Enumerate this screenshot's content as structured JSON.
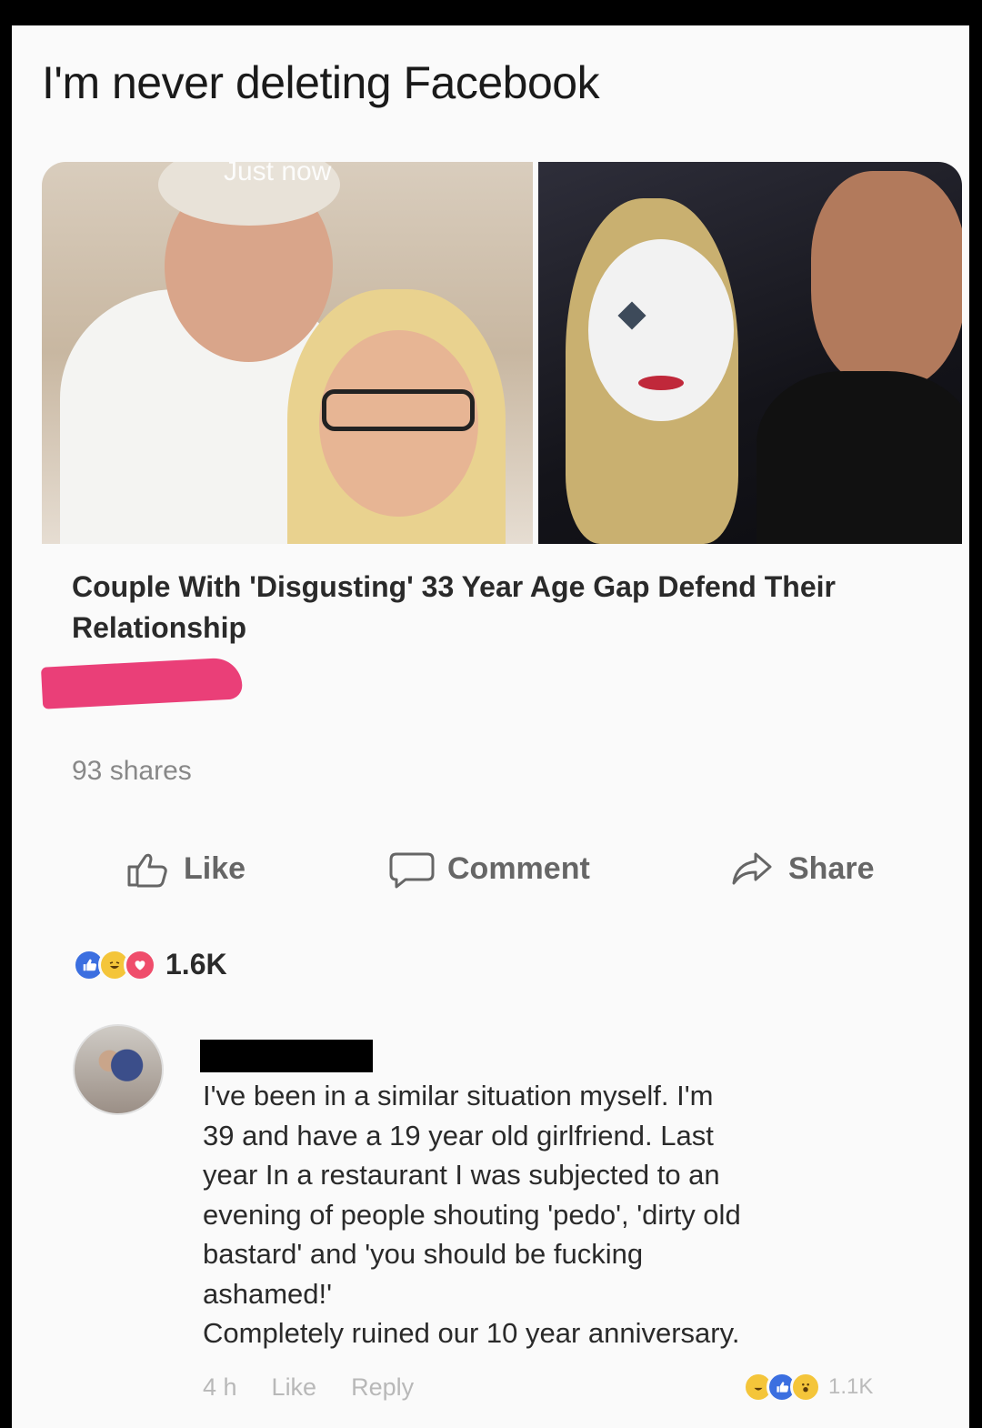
{
  "post": {
    "title": "I'm never deleting Facebook"
  },
  "link": {
    "image_overlay_text": "Just now",
    "headline": "Couple With 'Disgusting' 33 Year Age Gap Defend Their Relationship",
    "shares": "93 shares"
  },
  "actions": {
    "like": "Like",
    "comment": "Comment",
    "share": "Share"
  },
  "reactions": {
    "count": "1.6K",
    "icons": [
      "like-reaction",
      "haha-reaction",
      "love-reaction"
    ]
  },
  "comment": {
    "lines": [
      "I've been in a similar situation  myself. I'm",
      "39 and have a 19 year old girlfriend. Last",
      "year In a restaurant I was subjected to an",
      "evening of people shouting 'pedo', 'dirty old",
      "bastard' and 'you should be fucking",
      "ashamed!'",
      "Completely ruined our 10 year anniversary."
    ],
    "time": "4 h",
    "like": "Like",
    "reply": "Reply",
    "reaction_count": "1.1K",
    "reaction_icons": [
      "haha-reaction",
      "like-reaction",
      "wow-reaction"
    ]
  },
  "colors": {
    "redaction_pink": "#ea3f78",
    "like_blue": "#3b6fe0",
    "haha_yellow": "#f4c53a",
    "love_red": "#ef4d6b"
  }
}
